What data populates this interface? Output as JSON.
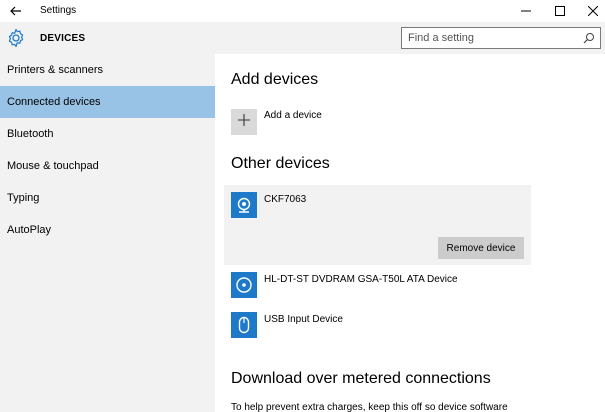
{
  "window": {
    "title": "Settings",
    "app_name": "DEVICES"
  },
  "search": {
    "placeholder": "Find a setting"
  },
  "sidebar": {
    "items": [
      {
        "label": "Printers & scanners"
      },
      {
        "label": "Connected devices"
      },
      {
        "label": "Bluetooth"
      },
      {
        "label": "Mouse & touchpad"
      },
      {
        "label": "Typing"
      },
      {
        "label": "AutoPlay"
      }
    ],
    "active_index": 1
  },
  "main": {
    "add_devices_heading": "Add devices",
    "add_device_label": "Add a device",
    "other_devices_heading": "Other devices",
    "devices": [
      {
        "name": "CKF7063",
        "icon": "webcam-icon"
      },
      {
        "name": "HL-DT-ST DVDRAM GSA-T50L ATA Device",
        "icon": "disc-drive-icon"
      },
      {
        "name": "USB Input Device",
        "icon": "mouse-icon"
      }
    ],
    "remove_device_label": "Remove device",
    "download_heading": "Download over metered connections",
    "download_text": "To help prevent extra charges, keep this off so device software"
  },
  "colors": {
    "accent": "#1e7ac8",
    "sidebar_active": "#99c3e6",
    "sidebar_bg": "#f2f2f2"
  }
}
